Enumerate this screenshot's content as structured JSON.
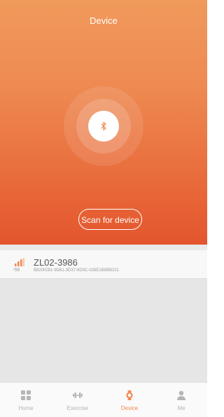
{
  "header": {
    "title": "Device"
  },
  "scan": {
    "button_label": "Scan for device"
  },
  "devices": [
    {
      "name": "ZL02-3986",
      "rssi": "-58",
      "uuid": "B8200281-9D61-3D37-8D0C-028E1B8BB221"
    }
  ],
  "tabs": [
    {
      "label": "Home",
      "icon": "grid-icon",
      "active": false
    },
    {
      "label": "Exercise",
      "icon": "dumbbell-icon",
      "active": false
    },
    {
      "label": "Device",
      "icon": "watch-icon",
      "active": true
    },
    {
      "label": "Me",
      "icon": "person-icon",
      "active": false
    }
  ],
  "colors": {
    "accent": "#F0884E",
    "hero_top": "#F09A5C",
    "hero_bottom": "#E4552D",
    "inactive_tab": "#B5B5B5"
  }
}
